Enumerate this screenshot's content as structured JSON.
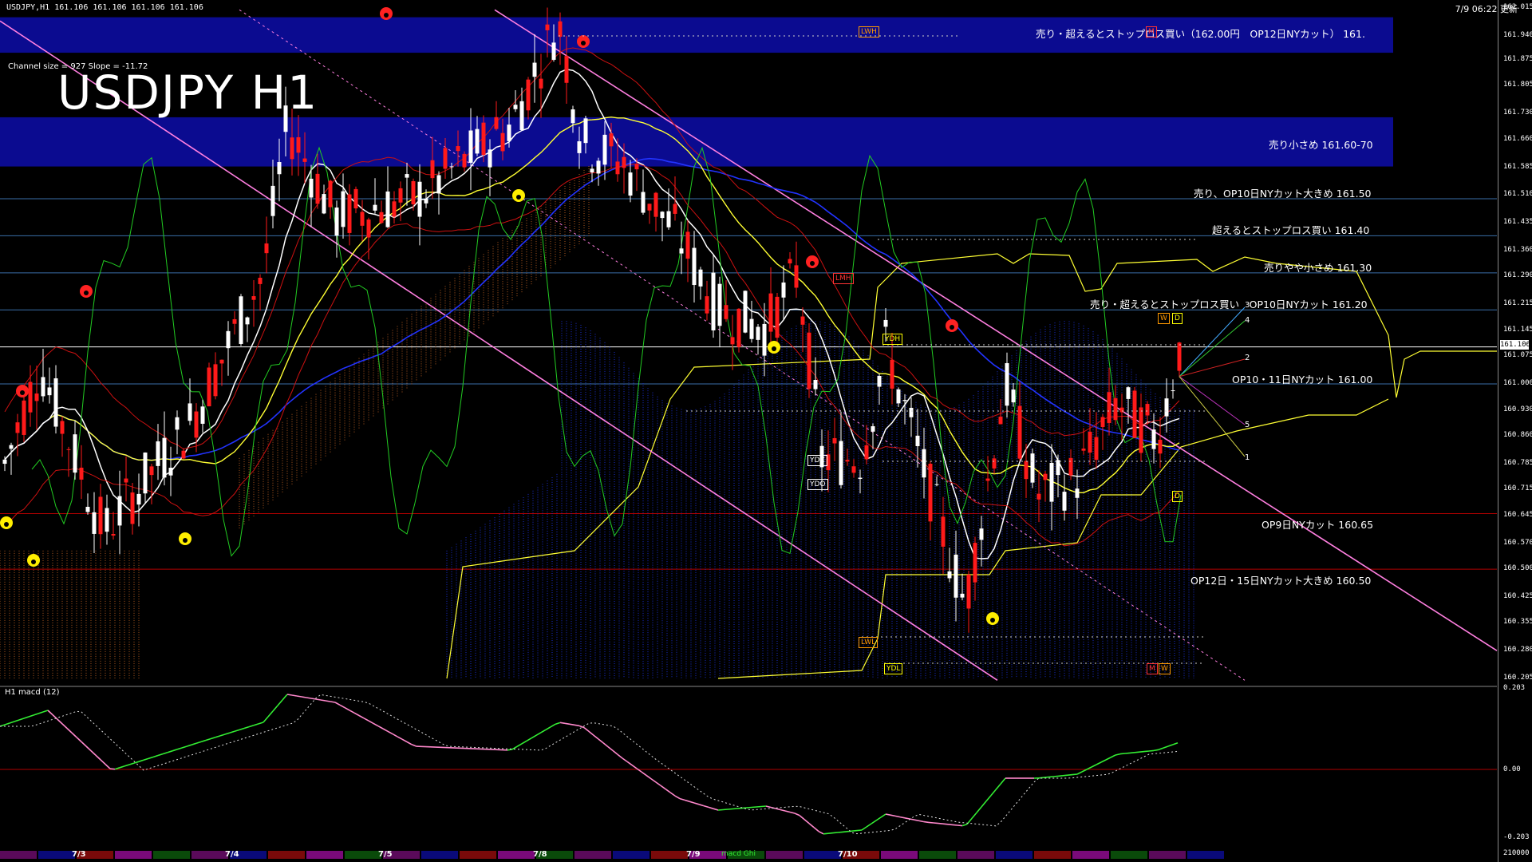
{
  "app": {
    "symbol_info": "USDJPY,H1  161.106 161.106 161.106 161.106",
    "clock": "7/9 06:22 更新",
    "channel_info": "Channel size = 927  Slope = -11.72",
    "title": "USDJPY H1",
    "macd_label": "H1  macd (12)"
  },
  "colors": {
    "background": "#000000",
    "zone": "#0b0b90",
    "bull_candle": "#ffffff",
    "bear_candle": "#ff1a1a",
    "channel": "#ff7fe0",
    "ma_white": "#ffffff",
    "ma_yellow": "#ffff33",
    "ma_blue": "#2233ff",
    "stoch_green": "#22cc22",
    "macd_green": "#33ee33",
    "macd_pink": "#ff88cc",
    "h_line_blue": "#3a6ea8",
    "h_line_red": "#b00000"
  },
  "price_axis": {
    "ticks": [
      "162.015",
      "161.940",
      "161.875",
      "161.805",
      "161.730",
      "161.660",
      "161.585",
      "161.510",
      "161.435",
      "161.360",
      "161.290",
      "161.215",
      "161.145",
      "161.075",
      "161.000",
      "160.930",
      "160.860",
      "160.785",
      "160.715",
      "160.645",
      "160.570",
      "160.500",
      "160.425",
      "160.355",
      "160.280",
      "160.205"
    ],
    "current_price": "161.106",
    "macd_ticks": [
      "0.203",
      "0.00",
      "-0.203"
    ],
    "macd_bottom": "210000"
  },
  "levels": [
    {
      "text": "売り・超えるとストップロス買い（162.00円　OP12日NYカット） 161.",
      "price": 161.96
    },
    {
      "text": "売り小さめ 161.60-70",
      "price": 161.65
    },
    {
      "text": "売り、OP10日NYカット大きめ 161.50",
      "price": 161.5
    },
    {
      "text": "超えるとストップロス買い 161.40",
      "price": 161.4
    },
    {
      "text": "売りやや小さめ 161.30",
      "price": 161.3
    },
    {
      "text": "売り・超えるとストップロス買い　OP10日NYカット 161.20",
      "price": 161.2
    },
    {
      "text": "OP10・11日NYカット 161.00",
      "price": 161.0
    },
    {
      "text": "OP9日NYカット 160.65",
      "price": 160.65
    },
    {
      "text": "OP12日・15日NYカット大きめ 160.50",
      "price": 160.5
    }
  ],
  "tags": [
    {
      "text": "LWH",
      "color": "#ff9900"
    },
    {
      "text": "M",
      "color": "#ff3333"
    },
    {
      "text": "LMH",
      "color": "#ff3333"
    },
    {
      "text": "YDH",
      "color": "#ffff00"
    },
    {
      "text": "YDC",
      "color": "#ffffff"
    },
    {
      "text": "YDO",
      "color": "#ffffff"
    },
    {
      "text": "LWL",
      "color": "#ff9900"
    },
    {
      "text": "YDL",
      "color": "#ffff00"
    },
    {
      "text": "W",
      "color": "#ff9900"
    },
    {
      "text": "D",
      "color": "#ffff00"
    }
  ],
  "side_numbers": [
    "3",
    "4",
    "2",
    "5",
    "1"
  ],
  "dates": [
    "7/3",
    "7/4",
    "7/5",
    "7/8",
    "7/9",
    "7/10"
  ],
  "timebar_note": "macd Ghi"
}
